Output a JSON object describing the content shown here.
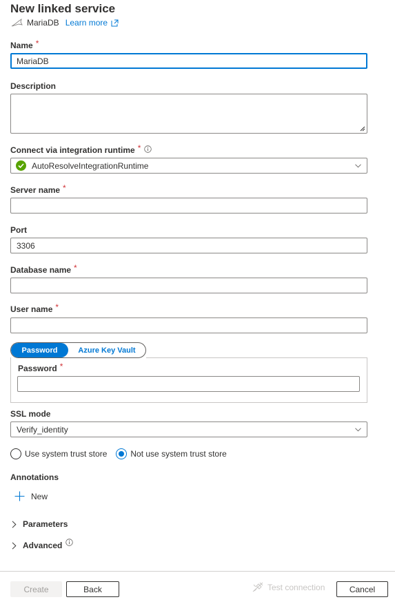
{
  "header": {
    "title": "New linked service",
    "service_name": "MariaDB",
    "service_icon": "mariadb-seal-icon",
    "learn_more": "Learn more",
    "learn_more_icon": "external-link-icon"
  },
  "form": {
    "name": {
      "label": "Name",
      "required": "*",
      "value": "MariaDB"
    },
    "description": {
      "label": "Description",
      "value": ""
    },
    "integration_runtime": {
      "label": "Connect via integration runtime",
      "required": "*",
      "info_icon": "info-icon",
      "value": "AutoResolveIntegrationRuntime",
      "status_icon": "green-check-icon"
    },
    "server_name": {
      "label": "Server name",
      "required": "*",
      "value": ""
    },
    "port": {
      "label": "Port",
      "value": "3306"
    },
    "database_name": {
      "label": "Database name",
      "required": "*",
      "value": ""
    },
    "user_name": {
      "label": "User name",
      "required": "*",
      "value": ""
    },
    "auth_toggle": {
      "options": [
        "Password",
        "Azure Key Vault"
      ],
      "selected": "Password"
    },
    "password": {
      "label": "Password",
      "required": "*",
      "value": ""
    },
    "ssl_mode": {
      "label": "SSL mode",
      "value": "Verify_identity"
    },
    "trust_store": {
      "options": [
        "Use system trust store",
        "Not use system trust store"
      ],
      "selected": "Not use system trust store"
    },
    "annotations": {
      "label": "Annotations",
      "new_label": "New"
    },
    "parameters": {
      "label": "Parameters"
    },
    "advanced": {
      "label": "Advanced"
    }
  },
  "footer": {
    "create": "Create",
    "back": "Back",
    "test_connection": "Test connection",
    "cancel": "Cancel"
  },
  "colors": {
    "accent": "#0078d4",
    "required": "#d13438",
    "success": "#57a300"
  }
}
